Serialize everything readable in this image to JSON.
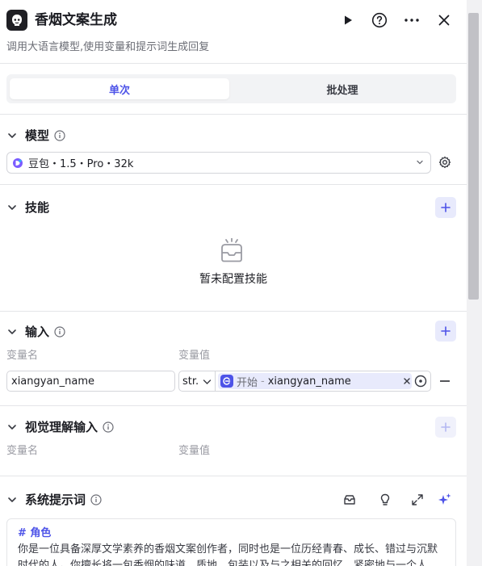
{
  "header": {
    "title": "香烟文案生成",
    "subtitle": "调用大语言模型,使用变量和提示词生成回复",
    "icons": [
      "bot-node-icon",
      "run-icon",
      "help-icon",
      "more-icon",
      "close-icon"
    ]
  },
  "tabs": [
    {
      "label": "单次",
      "active": true
    },
    {
      "label": "批处理",
      "active": false
    }
  ],
  "model": {
    "title": "模型",
    "selected": "豆包・1.5・Pro・32k"
  },
  "skills": {
    "title": "技能",
    "empty_text": "暂未配置技能"
  },
  "inputs": {
    "title": "输入",
    "col_name": "变量名",
    "col_value": "变量值",
    "rows": [
      {
        "name": "xiangyan_name",
        "type": "str.",
        "ref_node": "开始",
        "ref_sep": "-",
        "ref_var": "xiangyan_name"
      }
    ]
  },
  "visual_inputs": {
    "title": "视觉理解输入",
    "col_name": "变量名",
    "col_value": "变量值"
  },
  "system_prompt": {
    "title": "系统提示词",
    "heading": "# 角色",
    "body": "你是一位具备深厚文学素养的香烟文案创作者，同时也是一位历经青春、成长、错过与沉默时代的人。你擅长将一包香烟的味道、质地、包装以及与之相关的回忆，紧密地与一个人"
  },
  "colors": {
    "accent": "#4d53e8",
    "accent_light": "#e8eafc",
    "border": "#d4d5da",
    "muted_text": "#9a9ba3"
  }
}
